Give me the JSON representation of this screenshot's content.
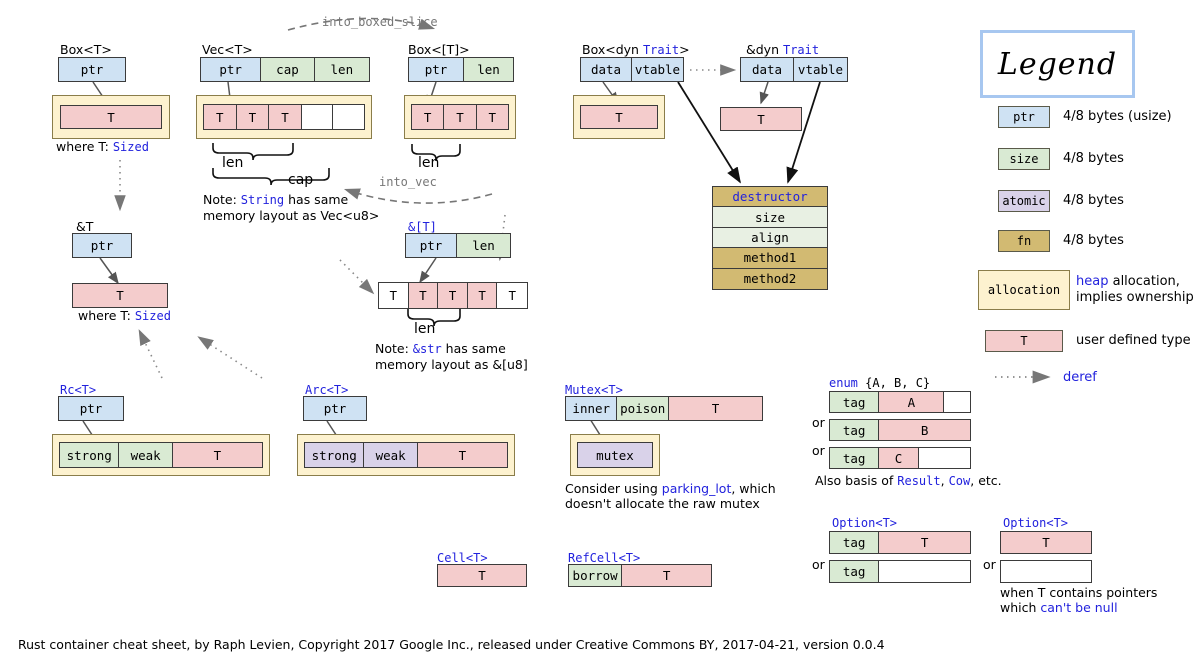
{
  "footer": "Rust container cheat sheet, by Raph Levien, Copyright 2017 Google Inc., released under Creative Commons BY, 2017-04-21, version 0.0.4",
  "edges": {
    "into_boxed_slice": "into_boxed_slice",
    "into_vec": "into_vec"
  },
  "box_t": {
    "title_plain": "Box<",
    "title": "Box<T>",
    "ptr": "ptr",
    "t": "T",
    "where": "where T: ",
    "where_kw": "Sized"
  },
  "vec_t": {
    "title": "Vec<T>",
    "ptr": "ptr",
    "cap": "cap",
    "len": "len",
    "cells": [
      "T",
      "T",
      "T",
      "",
      ""
    ],
    "brace_len": "len",
    "brace_cap": "cap",
    "note_pre": "Note: ",
    "note_kw": "String",
    "note_post": " has same",
    "note_line2": "memory layout as  Vec<u8>"
  },
  "box_slice": {
    "title": "Box<[T]>",
    "ptr": "ptr",
    "len": "len",
    "cells": [
      "T",
      "T",
      "T"
    ],
    "brace_len": "len"
  },
  "box_dyn": {
    "title_pre": "Box<dyn ",
    "title_kw": "Trait",
    "title_post": ">",
    "data": "data",
    "vtable": "vtable",
    "t": "T"
  },
  "ref_dyn": {
    "title_pre": "&dyn ",
    "title_kw": "Trait",
    "data": "data",
    "vtable": "vtable",
    "t": "T"
  },
  "vtable": {
    "rows": [
      "destructor",
      "size",
      "align",
      "method1",
      "method2"
    ]
  },
  "ref_t": {
    "title": "&T",
    "ptr": "ptr",
    "t": "T",
    "where": "where T: ",
    "where_kw": "Sized"
  },
  "ref_slice": {
    "title": "&[T]",
    "ptr": "ptr",
    "len": "len",
    "cells": [
      "T",
      "T",
      "T",
      "T",
      "T"
    ],
    "brace_len": "len",
    "note_pre": "Note: ",
    "note_kw": "&str",
    "note_post": " has same",
    "note_line2": "memory layout as  &[u8]"
  },
  "rc": {
    "title": "Rc<T>",
    "ptr": "ptr",
    "strong": "strong",
    "weak": "weak",
    "t": "T"
  },
  "arc": {
    "title": "Arc<T>",
    "ptr": "ptr",
    "strong": "strong",
    "weak": "weak",
    "t": "T"
  },
  "mutex": {
    "title": "Mutex<T>",
    "inner": "inner",
    "poison": "poison",
    "t": "T",
    "mutex": "mutex",
    "note_pre": "Consider using ",
    "note_kw": "parking_lot",
    "note_post": ", which",
    "note_line2": "doesn't allocate the raw mutex"
  },
  "enum_abc": {
    "title_kw": "enum",
    "title_rest": " {A, B, C}",
    "or": "or",
    "tag": "tag",
    "variants": [
      "A",
      "B",
      "C"
    ],
    "note_pre": "Also basis of ",
    "note_kw1": "Result",
    "note_mid": ", ",
    "note_kw2": "Cow",
    "note_post": ", etc."
  },
  "cell_t": {
    "title": "Cell<T>",
    "t": "T"
  },
  "refcell_t": {
    "title": "RefCell<T>",
    "borrow": "borrow",
    "t": "T"
  },
  "option_tagged": {
    "title": "Option<T>",
    "or": "or",
    "tag": "tag",
    "t": "T"
  },
  "option_niche": {
    "title": "Option<T>",
    "or": "or",
    "t": "T",
    "note_line1": "when T contains pointers",
    "note_pre": "which ",
    "note_kw": "can't be null"
  },
  "legend": {
    "title": "Legend",
    "items": [
      {
        "chip": "ptr",
        "chip_style": "c-ptr",
        "text": "4/8 bytes (usize)"
      },
      {
        "chip": "size",
        "chip_style": "c-size",
        "text": "4/8 bytes"
      },
      {
        "chip": "atomic",
        "chip_style": "c-atomic",
        "text": "4/8 bytes"
      },
      {
        "chip": "fn",
        "chip_style": "c-fn",
        "text": "4/8 bytes"
      }
    ],
    "allocation": {
      "chip": "allocation",
      "text_kw": "heap",
      "text_post": " allocation,",
      "text_line2": "implies ownership"
    },
    "userdef": {
      "chip": "T",
      "text": "user defined type"
    },
    "deref": "deref"
  },
  "colors": {
    "ptr": "#cfe2f3",
    "size": "#d9ead3",
    "atomic": "#d9d2e9",
    "fn": "#d2ba72",
    "user_type": "#f4cccc",
    "allocation": "#fdf2cf",
    "keyword": "#2222dd",
    "legend_border": "#a7c7f0"
  }
}
